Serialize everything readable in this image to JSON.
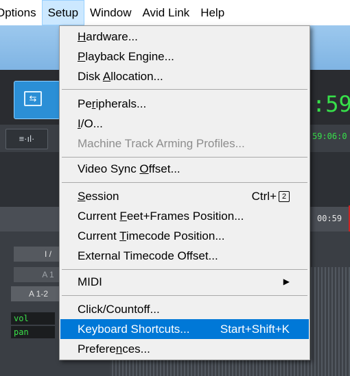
{
  "menubar": {
    "items": [
      "Options",
      "Setup",
      "Window",
      "Avid Link",
      "Help"
    ],
    "active": "Setup"
  },
  "background": {
    "clock": ":59",
    "timecode": "59:06:0",
    "ruler_timecode": "00:59",
    "io_label": "I /",
    "track_label_a": "A 1",
    "track_label_a12": "A 1-2",
    "param_vol": "vol",
    "param_pan": "pan"
  },
  "menu": {
    "items": [
      {
        "pre": "",
        "mn": "H",
        "post": "ardware...",
        "shortcut": ""
      },
      {
        "pre": "",
        "mn": "P",
        "post": "layback Engine...",
        "shortcut": ""
      },
      {
        "pre": "Disk ",
        "mn": "A",
        "post": "llocation...",
        "shortcut": ""
      },
      {
        "pre": "Pe",
        "mn": "r",
        "post": "ipherals...",
        "shortcut": ""
      },
      {
        "pre": "",
        "mn": "I",
        "post": "/O...",
        "shortcut": ""
      },
      {
        "pre": "Machine Track Arming Profiles...",
        "mn": "",
        "post": "",
        "shortcut": "",
        "disabled": true
      },
      {
        "pre": "Video Sync ",
        "mn": "O",
        "post": "ffset...",
        "shortcut": ""
      },
      {
        "pre": "",
        "mn": "S",
        "post": "ession",
        "shortcut": "Ctrl+",
        "shortcut_box": "2"
      },
      {
        "pre": "Current ",
        "mn": "F",
        "post": "eet+Frames Position...",
        "shortcut": ""
      },
      {
        "pre": "Current ",
        "mn": "T",
        "post": "imecode Position...",
        "shortcut": ""
      },
      {
        "pre": "External Timecode Offset...",
        "mn": "",
        "post": "",
        "shortcut": ""
      },
      {
        "pre": "MIDI",
        "mn": "",
        "post": "",
        "submenu": true
      },
      {
        "pre": "Click/Countoff...",
        "mn": "",
        "post": "",
        "shortcut": ""
      },
      {
        "pre": "Keyboard Shortcuts...",
        "mn": "",
        "post": "",
        "shortcut": "Start+Shift+K",
        "highlighted": true
      },
      {
        "pre": "Prefere",
        "mn": "n",
        "post": "ces...",
        "shortcut": ""
      }
    ]
  },
  "colors": {
    "highlight": "#0078d7",
    "menubar_active": "#cce8ff",
    "disabled_text": "#8d8d8d",
    "clock_green": "#37e04a"
  }
}
